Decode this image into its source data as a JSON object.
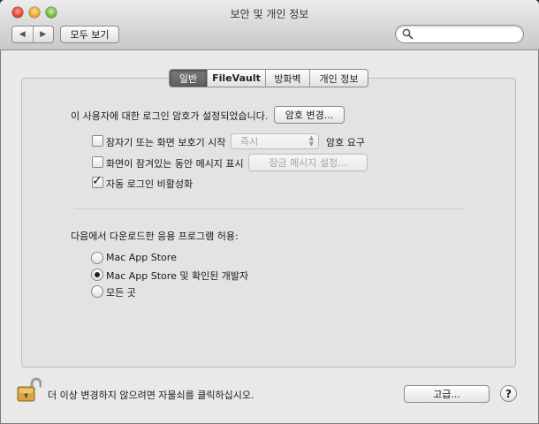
{
  "window": {
    "title": "보안 및 개인 정보"
  },
  "toolbar": {
    "back_icon": "◀",
    "forward_icon": "▶",
    "show_all_label": "모두 보기",
    "search_placeholder": "",
    "search_value": ""
  },
  "tabs": [
    {
      "label": "일반",
      "selected": true
    },
    {
      "label": "FileVault",
      "selected": false
    },
    {
      "label": "방화벽",
      "selected": false
    },
    {
      "label": "개인 정보",
      "selected": false
    }
  ],
  "general": {
    "password_set_text": "이 사용자에 대한 로그인 암호가 설정되었습니다.",
    "change_password_label": "암호 변경...",
    "require_password": {
      "label": "잠자기 또는 화면 보호기 시작",
      "checked": false,
      "delay_value": "즉시",
      "suffix": "암호 요구"
    },
    "show_message": {
      "label": "화면이 잠겨있는 동안 메시지 표시",
      "checked": false,
      "button_label": "잠금 메시지 설정..."
    },
    "disable_auto_login": {
      "label": "자동 로그인 비활성화",
      "checked": true
    },
    "download_heading": "다음에서 다운로드한 응용 프로그램 허용:",
    "download_options": [
      {
        "label": "Mac App Store",
        "selected": false
      },
      {
        "label": "Mac App Store 및 확인된 개발자",
        "selected": true
      },
      {
        "label": "모든 곳",
        "selected": false
      }
    ]
  },
  "footer": {
    "lock_text": "더 이상 변경하지 않으려면 자물쇠를 클릭하십시오.",
    "advanced_label": "고급...",
    "help_label": "?"
  },
  "colors": {
    "window_bg": "#e9e9e9",
    "panel_bg": "#e3e3e3",
    "selected_tab": "#6a6a6a",
    "lock_gold": "#d9a441"
  }
}
